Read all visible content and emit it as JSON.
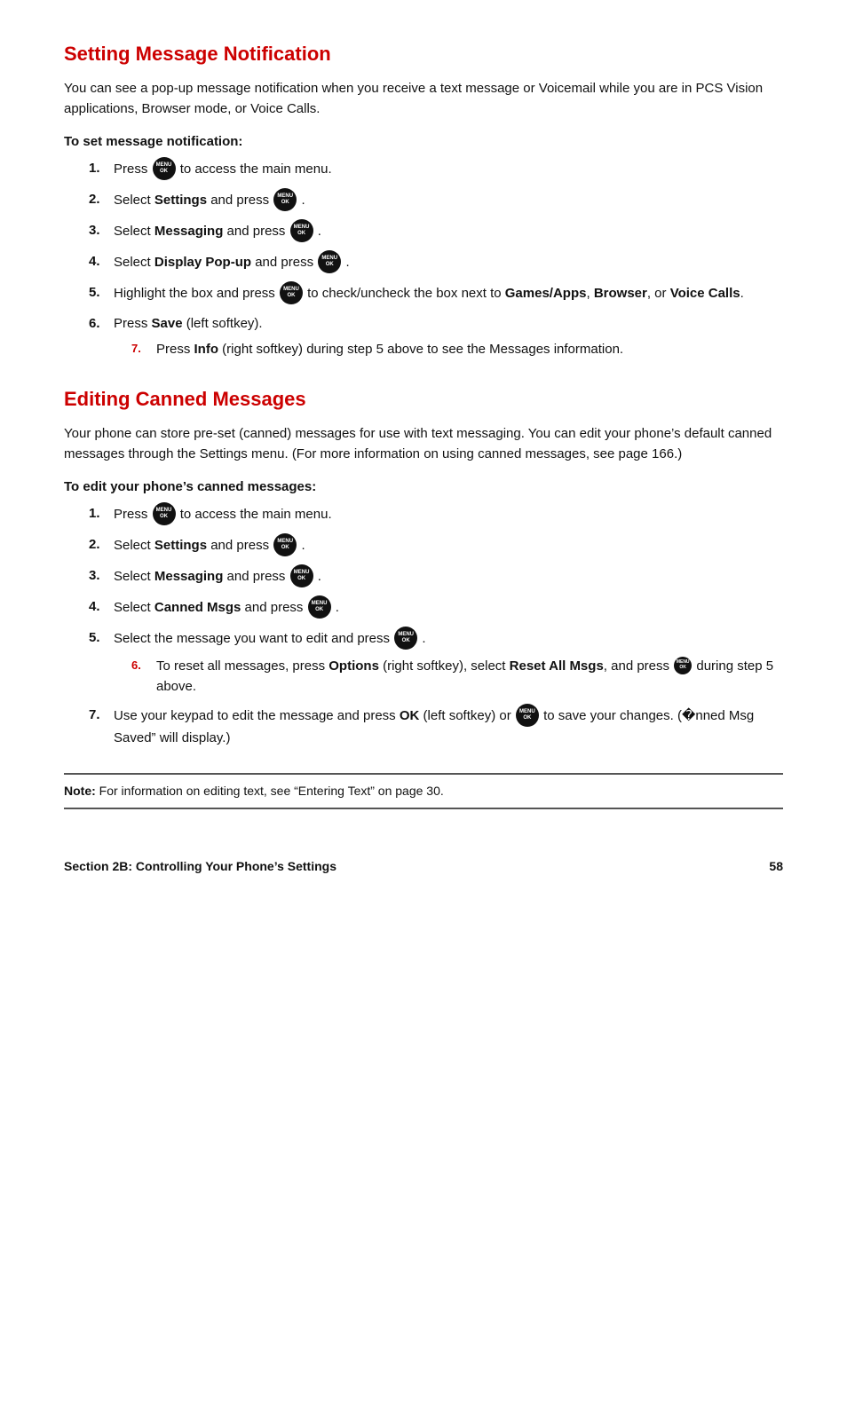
{
  "section1": {
    "title": "Setting Message Notification",
    "intro": "You can see a pop-up message notification when you receive a text message or Voicemail while you are in PCS Vision applications, Browser mode, or Voice Calls.",
    "instruction_label": "To set message notification:",
    "steps": [
      {
        "text_before": "Press",
        "icon": true,
        "text_after": "to access the main menu.",
        "bold": null
      },
      {
        "text_before": "Select",
        "bold": "Settings",
        "text_mid": "and press",
        "icon": true,
        "text_after": ".",
        "sub": null
      },
      {
        "text_before": "Select",
        "bold": "Messaging",
        "text_mid": "and press",
        "icon": true,
        "text_after": ".",
        "sub": null
      },
      {
        "text_before": "Select",
        "bold": "Display Pop-up",
        "text_mid": "and press",
        "icon": true,
        "text_after": ".",
        "sub": null
      },
      {
        "text_before": "Highlight the box and press",
        "icon": true,
        "text_after": "to check/uncheck the box next to",
        "bold_terms": [
          "Games/Apps",
          "Browser",
          "Voice Calls"
        ],
        "text_end": ".",
        "sub": null
      },
      {
        "text_before": "Press",
        "bold": "Save",
        "text_after": "(left softkey).",
        "sub": [
          "Press <b>Info</b> (right softkey) during step 5 above to see the Messages information."
        ]
      }
    ]
  },
  "section2": {
    "title": "Editing Canned Messages",
    "intro": "Your phone can store pre-set (canned) messages for use with text messaging. You can edit your phone’s default canned messages through the Settings menu. (For more information on using canned messages, see page 166.)",
    "instruction_label": "To edit your phone’s canned messages:",
    "steps": [
      {
        "text_before": "Press",
        "icon": true,
        "text_after": "to access the main menu."
      },
      {
        "text_before": "Select",
        "bold": "Settings",
        "text_mid": "and press",
        "icon": true,
        "text_after": "."
      },
      {
        "text_before": "Select",
        "bold": "Messaging",
        "text_mid": "and press",
        "icon": true,
        "text_after": "."
      },
      {
        "text_before": "Select",
        "bold": "Canned Msgs",
        "text_mid": "and press",
        "icon": true,
        "text_after": "."
      },
      {
        "text_before": "Select the message you want to edit and press",
        "icon": true,
        "text_after": ".",
        "sub": [
          "To reset all messages, press <b>Options</b> (right softkey), select <b>Reset All Msgs</b>, and press ● during step 5 above."
        ]
      },
      {
        "text_before": "Use your keypad to edit the message and press",
        "bold": "OK",
        "text_mid": "(left softkey) or",
        "icon": true,
        "text_after": "to save your changes. (“Canned Msg Saved” will display.)"
      }
    ]
  },
  "note": {
    "label": "Note:",
    "text": " For information on editing text, see “Entering Text” on page 30."
  },
  "footer": {
    "left": "Section 2B: Controlling Your Phone’s Settings",
    "right": "58"
  },
  "icons": {
    "menu_top": "MENU\nOK",
    "menu_small": "MENU\nOK"
  }
}
